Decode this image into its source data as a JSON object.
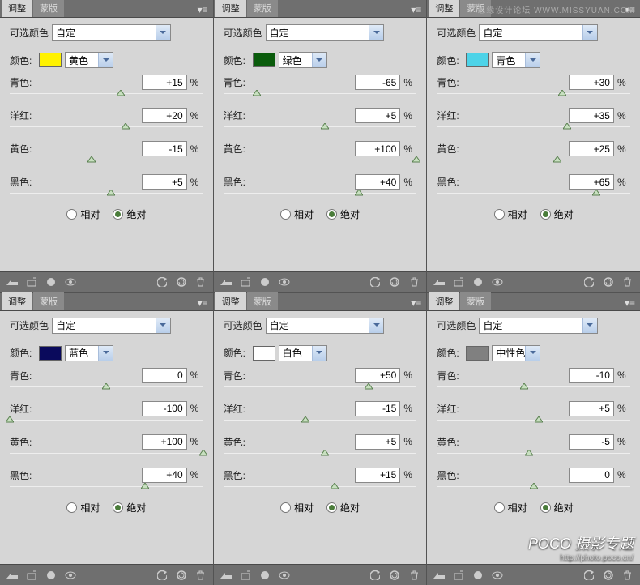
{
  "ui": {
    "tab_active": "调整",
    "tab_inactive": "蒙版",
    "preset_label": "可选颜色",
    "preset_value": "自定",
    "color_label": "颜色:",
    "sliders": {
      "cyan": "青色:",
      "magenta": "洋红:",
      "yellow": "黄色:",
      "black": "黑色:"
    },
    "unit": "%",
    "radio_relative": "相对",
    "radio_absolute": "绝对",
    "watermark": "思缘设计论坛  WWW.MISSYUAN.COM",
    "poco_title": "POCO 摄影专题",
    "poco_url": "http://photo.poco.cn/"
  },
  "panels": [
    {
      "color_name": "黄色",
      "swatch": "#fff200",
      "cyan": 15,
      "magenta": 20,
      "yellow": -15,
      "black": 5
    },
    {
      "color_name": "绿色",
      "swatch": "#0a5c0c",
      "cyan": -65,
      "magenta": 5,
      "yellow": 100,
      "black": 40
    },
    {
      "color_name": "青色",
      "swatch": "#4dd3e8",
      "cyan": 30,
      "magenta": 35,
      "yellow": 25,
      "black": 65
    },
    {
      "color_name": "蓝色",
      "swatch": "#0a0a5c",
      "cyan": 0,
      "magenta": -100,
      "yellow": 100,
      "black": 40
    },
    {
      "color_name": "白色",
      "swatch": "#ffffff",
      "cyan": 50,
      "magenta": -15,
      "yellow": 5,
      "black": 15
    },
    {
      "color_name": "中性色",
      "swatch": "#808080",
      "cyan": -10,
      "magenta": 5,
      "yellow": -5,
      "black": 0
    }
  ]
}
